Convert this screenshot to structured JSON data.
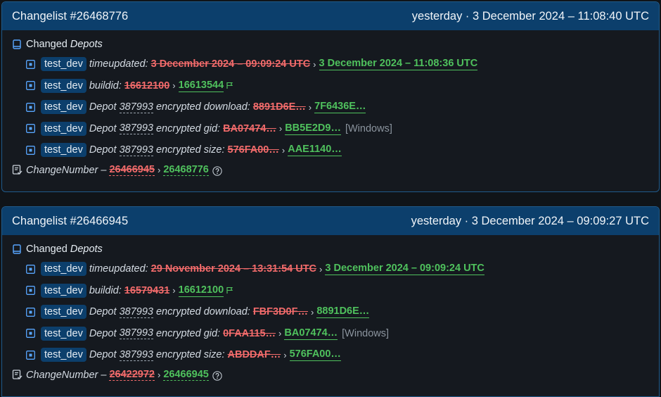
{
  "changelists": [
    {
      "title": "Changelist #26468776",
      "timestamp": "yesterday · 3 December 2024 – 11:08:40 UTC",
      "section_label": "Changed",
      "section_emph": "Depots",
      "rows": [
        {
          "app": "test_dev",
          "key": "timeupdated:",
          "old": "3 December 2024 – 09:09:24 UTC",
          "new": "3 December 2024 – 11:08:36 UTC"
        },
        {
          "app": "test_dev",
          "key": "buildid:",
          "old": "16612100",
          "new": "16613544",
          "flag_icon": "flag-icon"
        },
        {
          "app": "test_dev",
          "key_prefix": "Depot",
          "depot": "387993",
          "key": "encrypted download:",
          "old": "8891D6E…",
          "new": "7F6436E…"
        },
        {
          "app": "test_dev",
          "key_prefix": "Depot",
          "depot": "387993",
          "key": "encrypted gid:",
          "old": "BA07474…",
          "new": "BB5E2D9…",
          "os": "[Windows]"
        },
        {
          "app": "test_dev",
          "key_prefix": "Depot",
          "depot": "387993",
          "key": "encrypted size:",
          "old": "576FA00…",
          "new": "AAE1140…"
        }
      ],
      "change_number": {
        "label": "ChangeNumber –",
        "old": "26466945",
        "new": "26468776"
      }
    },
    {
      "title": "Changelist #26466945",
      "timestamp": "yesterday · 3 December 2024 – 09:09:27 UTC",
      "section_label": "Changed",
      "section_emph": "Depots",
      "rows": [
        {
          "app": "test_dev",
          "key": "timeupdated:",
          "old": "29 November 2024 – 13:31:54 UTC",
          "new": "3 December 2024 – 09:09:24 UTC"
        },
        {
          "app": "test_dev",
          "key": "buildid:",
          "old": "16579431",
          "new": "16612100",
          "flag_icon": "flag-icon"
        },
        {
          "app": "test_dev",
          "key_prefix": "Depot",
          "depot": "387993",
          "key": "encrypted download:",
          "old": "FBF3D0F…",
          "new": "8891D6E…"
        },
        {
          "app": "test_dev",
          "key_prefix": "Depot",
          "depot": "387993",
          "key": "encrypted gid:",
          "old": "0FAA115…",
          "new": "BA07474…",
          "os": "[Windows]"
        },
        {
          "app": "test_dev",
          "key_prefix": "Depot",
          "depot": "387993",
          "key": "encrypted size:",
          "old": "ABDDAF…",
          "new": "576FA00…"
        }
      ],
      "change_number": {
        "label": "ChangeNumber –",
        "old": "26422972",
        "new": "26466945"
      }
    }
  ],
  "colors": {
    "header": "#0c3f6c",
    "old": "#f26b6b",
    "new": "#4fc15d",
    "badge": "#0c3f6c"
  }
}
